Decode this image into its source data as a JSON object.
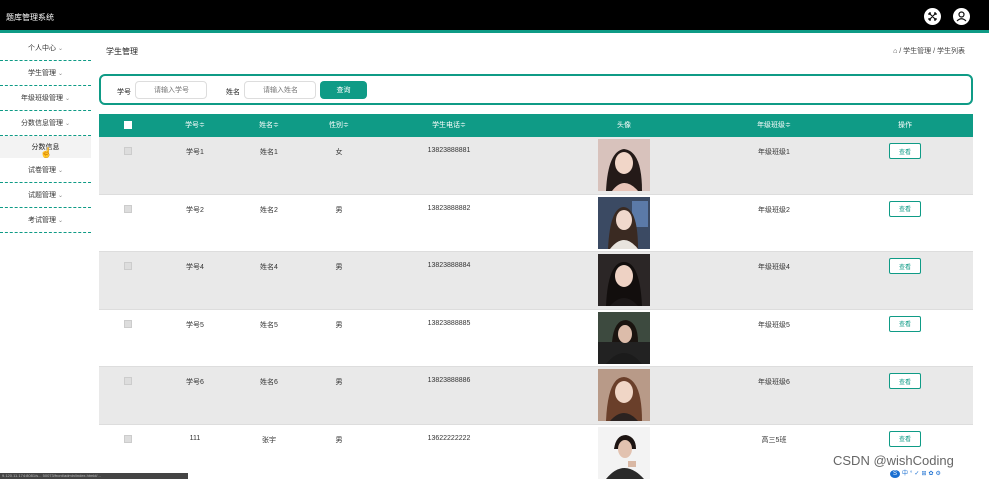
{
  "app": {
    "title": "题库管理系统"
  },
  "sidebar": {
    "items": [
      {
        "label": "个人中心"
      },
      {
        "label": "学生管理"
      },
      {
        "label": "年级班级管理"
      },
      {
        "label": "分数信息管理",
        "sub": "分数信息"
      },
      {
        "label": "试卷管理"
      },
      {
        "label": "试题管理"
      },
      {
        "label": "考试管理"
      }
    ],
    "chevron": "⌄"
  },
  "page": {
    "title": "学生管理",
    "breadcrumb": "/ 学生管理 / 学生列表"
  },
  "search": {
    "id_label": "学号",
    "id_placeholder": "请输入学号",
    "name_label": "姓名",
    "name_placeholder": "请输入姓名",
    "button": "查询"
  },
  "table": {
    "headers": [
      "学号≑",
      "姓名≑",
      "性别≑",
      "学生电话≑",
      "头像",
      "年级班级≑",
      "操作"
    ],
    "view_label": "查看",
    "rows": [
      {
        "id": "学号1",
        "name": "姓名1",
        "gender": "女",
        "phone": "13823888881",
        "class": "年级班级1"
      },
      {
        "id": "学号2",
        "name": "姓名2",
        "gender": "男",
        "phone": "13823888882",
        "class": "年级班级2"
      },
      {
        "id": "学号4",
        "name": "姓名4",
        "gender": "男",
        "phone": "13823888884",
        "class": "年级班级4"
      },
      {
        "id": "学号5",
        "name": "姓名5",
        "gender": "男",
        "phone": "13823888885",
        "class": "年级班级5"
      },
      {
        "id": "学号6",
        "name": "姓名6",
        "gender": "男",
        "phone": "13823888886",
        "class": "年级班级6"
      },
      {
        "id": "111",
        "name": "张宇",
        "gender": "男",
        "phone": "13622222222",
        "class": "高三5班"
      }
    ]
  },
  "watermark": "CSDN @wishCoding",
  "statusbar": "9.120.11.174:8081/s... 50073/front/admin/index.html#/...",
  "tray": [
    "中",
    "°",
    "✓",
    "⊞",
    "✿",
    "⚙"
  ],
  "colors": {
    "accent": "#0f9b86",
    "topbar": "#000000"
  }
}
